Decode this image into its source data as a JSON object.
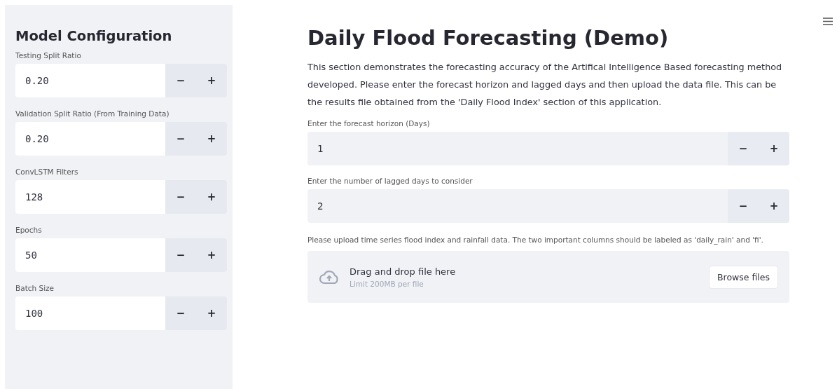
{
  "sidebar": {
    "title": "Model Configuration",
    "inputs": [
      {
        "label": "Testing Split Ratio",
        "value": "0.20"
      },
      {
        "label": "Validation Split Ratio (From Training Data)",
        "value": "0.20"
      },
      {
        "label": "ConvLSTM Filters",
        "value": "128"
      },
      {
        "label": "Epochs",
        "value": "50"
      },
      {
        "label": "Batch Size",
        "value": "100"
      }
    ]
  },
  "main": {
    "title": "Daily Flood Forecasting (Demo)",
    "description": "This section demonstrates the forecasting accuracy of the Artifical Intelligence Based forecasting method developed. Please enter the forecast horizon and lagged days and then upload the data file. This can be the results file obtained from the 'Daily Flood Index' section of this application.",
    "inputs": [
      {
        "label": "Enter the forecast horizon (Days)",
        "value": "1"
      },
      {
        "label": "Enter the number of lagged days to consider",
        "value": "2"
      }
    ],
    "upload": {
      "label": "Please upload time series flood index and rainfall data. The two important columns should be labeled as 'daily_rain' and 'fi'.",
      "title": "Drag and drop file here",
      "limit": "Limit 200MB per file",
      "button": "Browse files"
    }
  },
  "decrement": "−",
  "increment": "+"
}
